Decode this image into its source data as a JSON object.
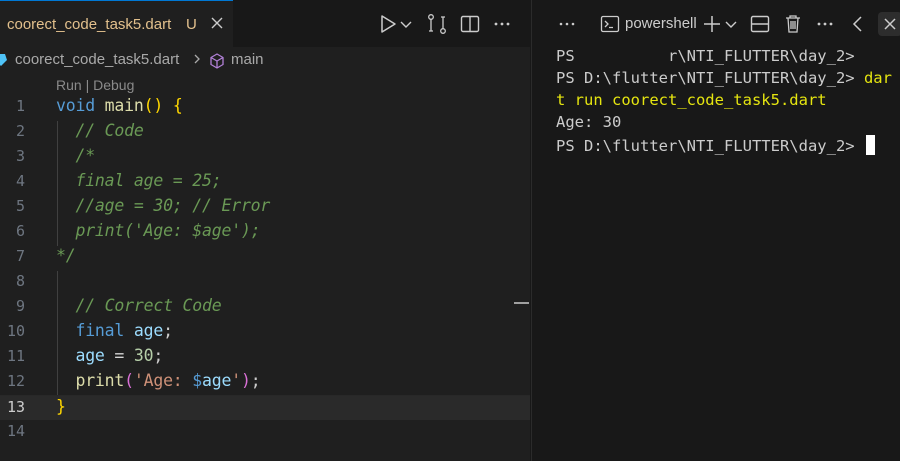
{
  "editor": {
    "tab": {
      "filename": "coorect_code_task5.dart",
      "modified_marker": "U"
    },
    "breadcrumbs": {
      "file": "coorect_code_task5.dart",
      "symbol": "main"
    },
    "codelens": "Run | Debug",
    "lines": [
      {
        "n": "1",
        "tokens": [
          [
            "void ",
            "#569cd6"
          ],
          [
            "main",
            "#dcdcaa"
          ],
          [
            "() ",
            "#ffd700"
          ],
          [
            "{",
            "#ffd700"
          ]
        ]
      },
      {
        "n": "2",
        "tokens": [
          [
            "  // Code",
            "#6a9955i"
          ]
        ]
      },
      {
        "n": "3",
        "tokens": [
          [
            "  /*",
            "#6a9955i"
          ]
        ]
      },
      {
        "n": "4",
        "tokens": [
          [
            "  final age = 25;",
            "#6a9955i"
          ]
        ]
      },
      {
        "n": "5",
        "tokens": [
          [
            "  //age = 30; // Error",
            "#6a9955i"
          ]
        ]
      },
      {
        "n": "6",
        "tokens": [
          [
            "  print('Age: $age');",
            "#6a9955i"
          ]
        ]
      },
      {
        "n": "7",
        "tokens": [
          [
            "*/",
            "#6a9955i"
          ]
        ]
      },
      {
        "n": "8",
        "tokens": []
      },
      {
        "n": "9",
        "tokens": [
          [
            "  // Correct Code",
            "#6a9955i"
          ]
        ]
      },
      {
        "n": "10",
        "tokens": [
          [
            "  ",
            "#cccccc"
          ],
          [
            "final ",
            "#569cd6"
          ],
          [
            "age",
            "#9cdcfe"
          ],
          [
            ";",
            "#cccccc"
          ]
        ]
      },
      {
        "n": "11",
        "tokens": [
          [
            "  ",
            "#cccccc"
          ],
          [
            "age",
            "#9cdcfe"
          ],
          [
            " = ",
            "#d4d4d4"
          ],
          [
            "30",
            "#b5cea8"
          ],
          [
            ";",
            "#cccccc"
          ]
        ]
      },
      {
        "n": "12",
        "tokens": [
          [
            "  ",
            "#cccccc"
          ],
          [
            "print",
            "#dcdcaa"
          ],
          [
            "(",
            "#da70d6"
          ],
          [
            "'Age: ",
            "#ce9178"
          ],
          [
            "$",
            "#569cd6"
          ],
          [
            "age",
            "#9cdcfe"
          ],
          [
            "'",
            "#ce9178"
          ],
          [
            ")",
            "#da70d6"
          ],
          [
            ";",
            "#cccccc"
          ]
        ]
      },
      {
        "n": "13",
        "tokens": [
          [
            "}",
            "#ffd700"
          ]
        ]
      },
      {
        "n": "14",
        "tokens": []
      }
    ],
    "current_line": "13"
  },
  "terminal": {
    "shell_label": "powershell",
    "lines": [
      {
        "text": "PS          r\\NTI_FLUTTER\\day_2>",
        "cmd": ""
      },
      {
        "text": "PS D:\\flutter\\NTI_FLUTTER\\day_2> ",
        "cmd": "dar"
      },
      {
        "text": "",
        "cmd": "t run coorect_code_task5.dart"
      },
      {
        "text": "Age: 30",
        "cmd": ""
      },
      {
        "text": "PS D:\\flutter\\NTI_FLUTTER\\day_2> ",
        "cmd": ""
      }
    ]
  },
  "colors": {
    "accent": "#0078d4",
    "modified": "#e2c08d",
    "cmd_yellow": "#e5e510"
  },
  "icons": [
    "close-icon",
    "run-icon",
    "chevron-down-icon",
    "compare-changes-icon",
    "split-editor-icon",
    "more-icon",
    "dart-file-icon",
    "symbol-method-icon",
    "terminal-icon",
    "plus-icon",
    "split-terminal-icon",
    "trash-icon",
    "chevron-left-icon"
  ]
}
